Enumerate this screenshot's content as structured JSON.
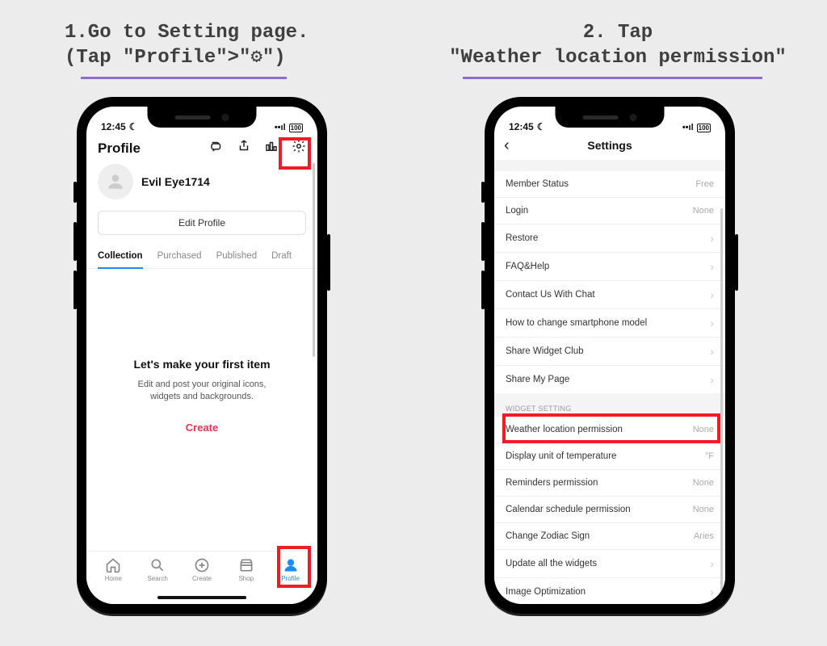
{
  "step1": {
    "heading": "1.Go to Setting page.\n(Tap \"Profile\">\"⚙\")"
  },
  "step2": {
    "heading": "2. Tap\n\"Weather location permission\""
  },
  "phone1": {
    "status": {
      "time": "12:45",
      "battery": "100"
    },
    "title": "Profile",
    "username": "Evil Eye1714",
    "edit_label": "Edit Profile",
    "tabs": [
      "Collection",
      "Purchased",
      "Published",
      "Draft"
    ],
    "empty": {
      "title": "Let's make your first item",
      "sub": "Edit and post your original icons,\nwidgets and backgrounds.",
      "create": "Create"
    },
    "tabbar": [
      "Home",
      "Search",
      "Create",
      "Shop",
      "Profile"
    ]
  },
  "phone2": {
    "status": {
      "time": "12:45",
      "battery": "100"
    },
    "title": "Settings",
    "rows1": [
      {
        "label": "Member Status",
        "value": "Free"
      },
      {
        "label": "Login",
        "value": "None"
      },
      {
        "label": "Restore",
        "value": "›"
      },
      {
        "label": "FAQ&Help",
        "value": "›"
      },
      {
        "label": "Contact Us With Chat",
        "value": "›"
      },
      {
        "label": "How to change smartphone model",
        "value": "›"
      },
      {
        "label": "Share Widget Club",
        "value": "›"
      },
      {
        "label": "Share My Page",
        "value": "›"
      }
    ],
    "section2_label": "WIDGET SETTING",
    "rows2": [
      {
        "label": "Weather location permission",
        "value": "None"
      },
      {
        "label": "Display unit of temperature",
        "value": "°F"
      },
      {
        "label": "Reminders permission",
        "value": "None"
      },
      {
        "label": "Calendar schedule permission",
        "value": "None"
      },
      {
        "label": "Change Zodiac Sign",
        "value": "Aries"
      },
      {
        "label": "Update all the widgets",
        "value": "›"
      },
      {
        "label": "Image Optimization",
        "value": "›"
      }
    ]
  }
}
